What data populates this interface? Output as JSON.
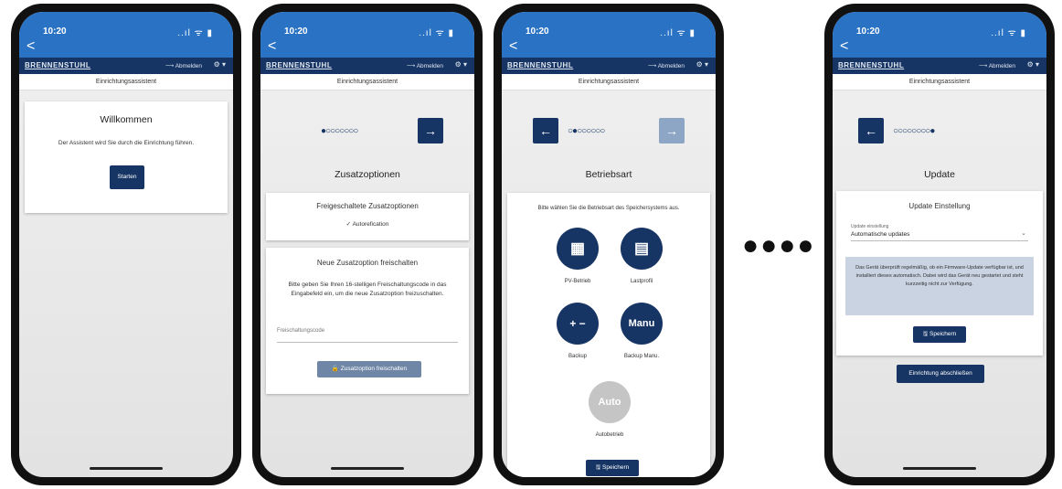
{
  "status": {
    "time": "10:20",
    "icons": "..ıl ᯤ ▮"
  },
  "common": {
    "back": "<",
    "brand": "BRENNENSTUHL",
    "logout": "⟶ Abmelden",
    "lang": "⚙ ▾",
    "screen_title": "Einrichtungsassistent"
  },
  "ellipsis": "●●●●",
  "phone1": {
    "heading": "Willkommen",
    "text": "Der Assistent wird Sie durch die Einrichtung führen.",
    "start_label": "Starten"
  },
  "phone2": {
    "dots": "●○○○○○○○",
    "next": "→",
    "heading": "Zusatzoptionen",
    "card1_title": "Freigeschaltete Zusatzoptionen",
    "card1_item": "✓  Autorefication",
    "card2_title": "Neue Zusatzoption freischalten",
    "card2_text": "Bitte geben Sie Ihren 16-stelligen Freischaltungscode in das Eingabefeld ein, um die neue Zusatzoption freizuschalten.",
    "code_placeholder": "Freischaltungscode",
    "unlock_label": "🔓 Zusatzoption freischalten"
  },
  "phone3": {
    "prev": "←",
    "dots": "○●○○○○○○",
    "next": "→",
    "heading": "Betriebsart",
    "intro": "Bitte wählen Sie die Betriebsart des Speichersystems aus.",
    "modes": [
      {
        "label": "PV-Betrieb",
        "icon": "solar-panel-icon",
        "glyph": "▦"
      },
      {
        "label": "Lastprofil",
        "icon": "meter-icon",
        "glyph": "▤"
      },
      {
        "label": "Backup",
        "icon": "battery-icon",
        "glyph": "+ −"
      },
      {
        "label": "Backup Manu.",
        "icon": "manual-backup-icon",
        "glyph": "Manu"
      },
      {
        "label": "Autobetrieb",
        "icon": "auto-mode-icon",
        "glyph": "Auto"
      }
    ],
    "save_label": "🖫 Speichern"
  },
  "phone4": {
    "prev": "←",
    "dots": "○○○○○○○○●",
    "heading": "Update",
    "card_title": "Update Einstellung",
    "select_label": "Update einstellung",
    "select_value": "Automatische updates",
    "info": "Das Gerät überprüft regelmäßig, ob ein Firmware-Update verfügbar ist, und installiert dieses automatisch. Dabei wird das Gerät neu gestartet und steht kurzzeitig nicht zur Verfügung.",
    "save_label": "🖫 Speichern",
    "finish_label": "Einrichtung abschließen"
  }
}
